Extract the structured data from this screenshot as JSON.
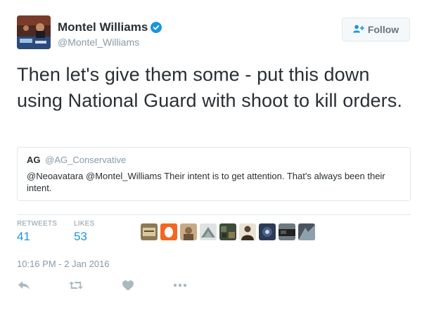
{
  "author": {
    "name": "Montel Williams",
    "handle": "@Montel_Williams",
    "verified_icon": "verified-badge-icon",
    "avatar_icon": "avatar-photo"
  },
  "follow_button": {
    "label": "Follow",
    "icon": "add-user-icon"
  },
  "tweet": {
    "text": "Then let's give them some - put this down using National Guard with shoot to kill orders."
  },
  "quoted_tweet": {
    "name": "AG",
    "handle": "@AG_Conservative",
    "text": "@Neoavatara @Montel_Williams Their intent is to get attention. That's always been their intent."
  },
  "stats": {
    "retweets_label": "RETWEETS",
    "retweets_value": "41",
    "likes_label": "LIKES",
    "likes_value": "53"
  },
  "likers": [
    {
      "icon": "liker-avatar-1",
      "color": "#8b7a55"
    },
    {
      "icon": "liker-avatar-2",
      "color": "#f26722"
    },
    {
      "icon": "liker-avatar-3",
      "color": "#a07c52"
    },
    {
      "icon": "liker-avatar-4",
      "color": "#7a8c8a"
    },
    {
      "icon": "liker-avatar-5",
      "color": "#3e4a3a"
    },
    {
      "icon": "liker-avatar-6",
      "color": "#5a4630"
    },
    {
      "icon": "liker-avatar-7",
      "color": "#2d3b55"
    },
    {
      "icon": "liker-avatar-8",
      "color": "#333333"
    },
    {
      "icon": "liker-avatar-9",
      "color": "#4a5560"
    }
  ],
  "timestamp": "10:16 PM - 2 Jan 2016",
  "actions": [
    "reply-icon",
    "retweet-icon",
    "like-icon",
    "more-icon"
  ],
  "colors": {
    "accent": "#1b95e0",
    "muted": "#8899a6",
    "text": "#292f33",
    "border": "#e1e8ed"
  }
}
